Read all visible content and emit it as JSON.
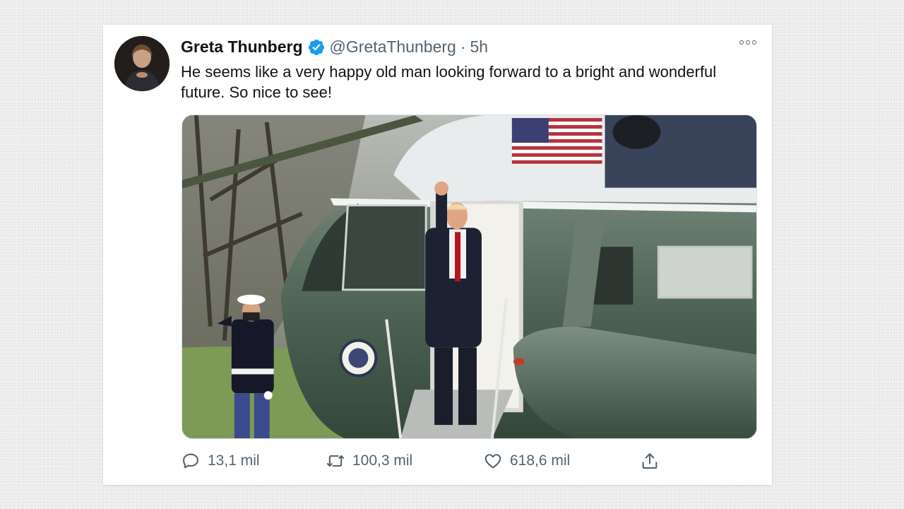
{
  "tweet": {
    "author_name": "Greta Thunberg",
    "author_handle": "@GretaThunberg",
    "separator": "·",
    "time": "5h",
    "text": "He seems like a very happy old man looking forward to a bright and wonderful future. So nice to see!",
    "verified_color": "#1d9bf0",
    "icons": {
      "more": "more-options-icon",
      "reply": "reply-icon",
      "retweet": "retweet-icon",
      "like": "like-icon",
      "share": "share-icon"
    }
  },
  "actions": {
    "replies": "13,1 mil",
    "retweets": "100,3 mil",
    "likes": "618,6 mil"
  }
}
